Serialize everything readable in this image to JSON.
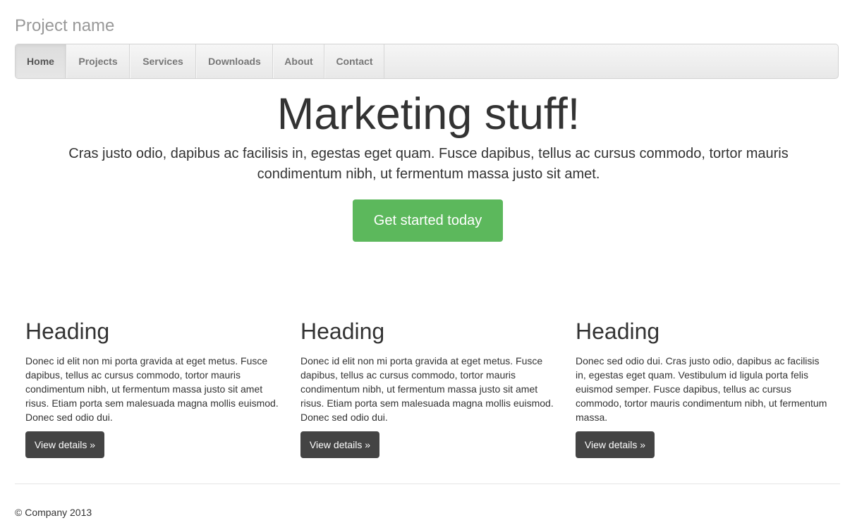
{
  "brand": "Project name",
  "nav": {
    "items": [
      {
        "label": "Home"
      },
      {
        "label": "Projects"
      },
      {
        "label": "Services"
      },
      {
        "label": "Downloads"
      },
      {
        "label": "About"
      },
      {
        "label": "Contact"
      }
    ],
    "active": "Home"
  },
  "hero": {
    "title": "Marketing stuff!",
    "lead": "Cras justo odio, dapibus ac facilisis in, egestas eget quam. Fusce dapibus, tellus ac cursus commodo, tortor mauris condimentum nibh, ut fermentum massa justo sit amet.",
    "cta_label": "Get started today"
  },
  "columns": [
    {
      "heading": "Heading",
      "text": "Donec id elit non mi porta gravida at eget metus. Fusce dapibus, tellus ac cursus commodo, tortor mauris condimentum nibh, ut fermentum massa justo sit amet risus. Etiam porta sem malesuada magna mollis euismod. Donec sed odio dui.",
      "button": "View details »"
    },
    {
      "heading": "Heading",
      "text": "Donec id elit non mi porta gravida at eget metus. Fusce dapibus, tellus ac cursus commodo, tortor mauris condimentum nibh, ut fermentum massa justo sit amet risus. Etiam porta sem malesuada magna mollis euismod. Donec sed odio dui.",
      "button": "View details »"
    },
    {
      "heading": "Heading",
      "text": "Donec sed odio dui. Cras justo odio, dapibus ac facilisis in, egestas eget quam. Vestibulum id ligula porta felis euismod semper. Fusce dapibus, tellus ac cursus commodo, tortor mauris condimentum nibh, ut fermentum massa.",
      "button": "View details »"
    }
  ],
  "footer": {
    "text": "© Company 2013"
  },
  "colors": {
    "cta": "#5cb85c",
    "details_button": "#444444",
    "brand_text": "#999999"
  }
}
